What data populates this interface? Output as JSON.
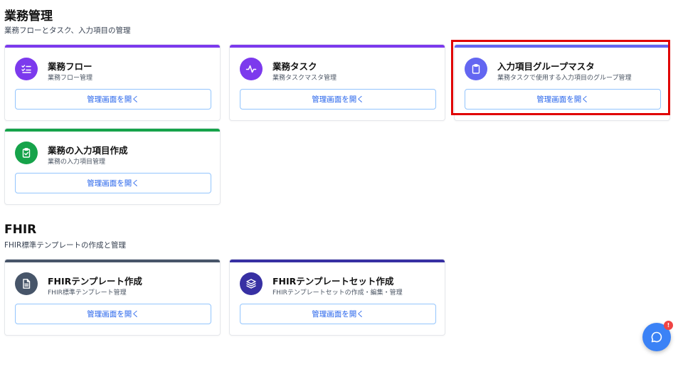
{
  "sections": [
    {
      "title": "業務管理",
      "subtitle": "業務フローとタスク、入力項目の管理",
      "cards": [
        {
          "title": "業務フロー",
          "desc": "業務フロー管理",
          "button": "管理画面を開く",
          "accent": "#7c3aed",
          "icon": "checklist-icon"
        },
        {
          "title": "業務タスク",
          "desc": "業務タスクマスタ管理",
          "button": "管理画面を開く",
          "accent": "#7c3aed",
          "icon": "activity-icon"
        },
        {
          "title": "入力項目グループマスタ",
          "desc": "業務タスクで使用する入力項目のグループ管理",
          "button": "管理画面を開く",
          "accent": "#6366f1",
          "icon": "clipboard-icon"
        },
        {
          "title": "業務の入力項目作成",
          "desc": "業務の入力項目管理",
          "button": "管理画面を開く",
          "accent": "#16a34a",
          "icon": "clipboard-check-icon"
        }
      ]
    },
    {
      "title": "FHIR",
      "subtitle": "FHIR標準テンプレートの作成と管理",
      "cards": [
        {
          "title": "FHIRテンプレート作成",
          "desc": "FHIR標準テンプレート管理",
          "button": "管理画面を開く",
          "accent": "#475569",
          "icon": "document-icon"
        },
        {
          "title": "FHIRテンプレートセット作成",
          "desc": "FHIRテンプレートセットの作成・編集・管理",
          "button": "管理画面を開く",
          "accent": "#3730a3",
          "icon": "layers-icon"
        }
      ]
    }
  ],
  "chat": {
    "badge": "!",
    "icon": "chat-icon"
  }
}
